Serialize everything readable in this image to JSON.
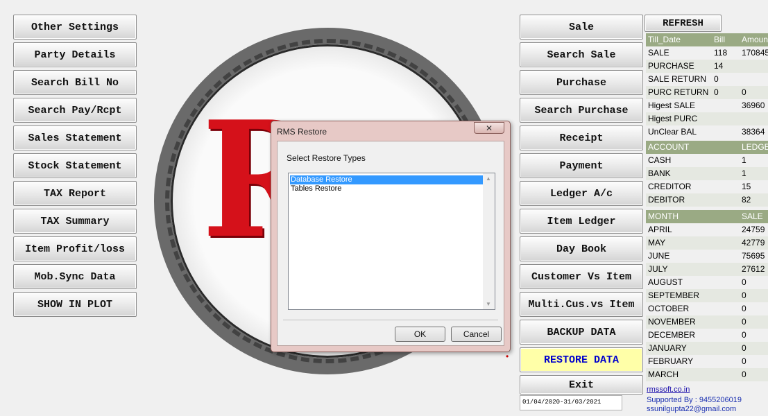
{
  "left_menu": [
    "Other Settings",
    "Party Details",
    "Search Bill No",
    "Search Pay/Rcpt",
    "Sales Statement",
    "Stock Statement",
    "TAX Report",
    "TAX Summary",
    "Item Profit/loss",
    "Mob.Sync Data",
    "SHOW IN PLOT"
  ],
  "right_menu": [
    "Sale",
    "Search Sale",
    "Purchase",
    "Search Purchase",
    "Receipt",
    "Payment",
    "Ledger A/c",
    "Item Ledger",
    "Day Book",
    "Customer Vs Item",
    "Multi.Cus.vs Item",
    "BACKUP DATA",
    "RESTORE DATA",
    "Exit"
  ],
  "refresh_label": "REFRESH",
  "logo_text": "RMS",
  "dialog": {
    "title": "RMS Restore",
    "close_glyph": "✕",
    "label": "Select Restore Types",
    "items": [
      "Database Restore",
      "Tables Restore"
    ],
    "ok_label": "OK",
    "cancel_label": "Cancel"
  },
  "summary": {
    "header": [
      "Till_Date",
      "Bill",
      "Amount"
    ],
    "rows": [
      {
        "label": "SALE",
        "bill": "118",
        "amount": "170845"
      },
      {
        "label": "PURCHASE",
        "bill": "14",
        "amount": ""
      },
      {
        "label": "SALE RETURN",
        "bill": "0",
        "amount": ""
      },
      {
        "label": "PURC RETURN",
        "bill": "0",
        "amount": "0"
      },
      {
        "label": "Higest SALE",
        "bill": "",
        "amount": "36960"
      },
      {
        "label": "Higest PURC",
        "bill": "",
        "amount": ""
      },
      {
        "label": "UnClear BAL",
        "bill": "",
        "amount": "38364"
      }
    ]
  },
  "accounts": {
    "header": [
      "ACCOUNT",
      "LEDGER"
    ],
    "rows": [
      {
        "label": "CASH",
        "value": "1"
      },
      {
        "label": "BANK",
        "value": "1"
      },
      {
        "label": "CREDITOR",
        "value": "15"
      },
      {
        "label": "DEBITOR",
        "value": "82"
      }
    ]
  },
  "months": {
    "header": [
      "MONTH",
      "SALE"
    ],
    "rows": [
      {
        "label": "APRIL",
        "value": "24759"
      },
      {
        "label": "MAY",
        "value": "42779"
      },
      {
        "label": "JUNE",
        "value": "75695"
      },
      {
        "label": "JULY",
        "value": "27612"
      },
      {
        "label": "AUGUST",
        "value": "0"
      },
      {
        "label": "SEPTEMBER",
        "value": "0"
      },
      {
        "label": "OCTOBER",
        "value": "0"
      },
      {
        "label": "NOVEMBER",
        "value": "0"
      },
      {
        "label": "DECEMBER",
        "value": "0"
      },
      {
        "label": "JANUARY",
        "value": "0"
      },
      {
        "label": "FEBRUARY",
        "value": "0"
      },
      {
        "label": "MARCH",
        "value": "0"
      }
    ]
  },
  "date_range": "01/04/2020-31/03/2021",
  "footer": {
    "website": "rmssoft.co.in",
    "support": "Supported By : 9455206019",
    "email": "ssunilgupta22@gmail.com"
  },
  "colors": {
    "header_bg": "#9aaa84",
    "active_button": "#ffffa8",
    "logo_red": "#d5111a"
  }
}
